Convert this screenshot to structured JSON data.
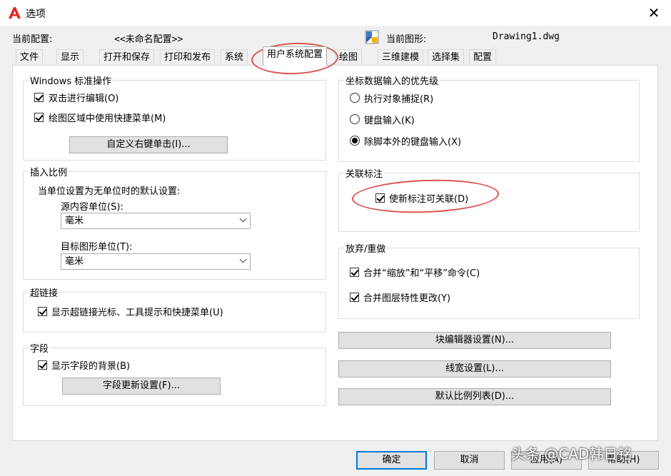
{
  "window": {
    "title": "选项",
    "close_label": "✕"
  },
  "profile": {
    "current_config_label": "当前配置:",
    "current_config_value": "<<未命名配置>>",
    "current_drawing_label": "当前图形:",
    "current_drawing_value": "Drawing1.dwg"
  },
  "tabs": [
    "文件",
    "显示",
    "打开和保存",
    "打印和发布",
    "系统",
    "用户系统配置",
    "绘图",
    "三维建模",
    "选择集",
    "配置"
  ],
  "active_tab": "用户系统配置",
  "windows_ops": {
    "title": "Windows 标准操作",
    "double_click": "双击进行编辑(O)",
    "shortcut_menu": "绘图区域中使用快捷菜单(M)",
    "custom_right_click": "自定义右键单击(I)..."
  },
  "insert_scale": {
    "title": "插入比例",
    "description": "当单位设置为无单位时的默认设置:",
    "source_label": "源内容单位(S):",
    "source_value": "毫米",
    "target_label": "目标图形单位(T):",
    "target_value": "毫米"
  },
  "hyperlink": {
    "title": "超链接",
    "option": "显示超链接光标、工具提示和快捷菜单(U)"
  },
  "fields": {
    "title": "字段",
    "show_background": "显示字段的背景(B)",
    "update_settings": "字段更新设置(F)..."
  },
  "coord_priority": {
    "title": "坐标数据输入的优先级",
    "options": [
      "执行对象捕捉(R)",
      "键盘输入(K)",
      "除脚本外的键盘输入(X)"
    ],
    "selected": "除脚本外的键盘输入(X)"
  },
  "assoc_dim": {
    "title": "关联标注",
    "option": "使新标注可关联(D)"
  },
  "undo_redo": {
    "title": "放弃/重做",
    "combine_zoom_pan": "合并“缩放”和“平移”命令(C)",
    "combine_layer": "合并图层特性更改(Y)"
  },
  "right_buttons": {
    "block_editor": "块编辑器设置(N)...",
    "lineweight": "线宽设置(L)...",
    "scale_list": "默认比例列表(D)..."
  },
  "footer": {
    "ok": "确定",
    "cancel": "取消",
    "apply": "应用(A)",
    "help": "帮助(H)"
  },
  "watermark": "头条 @CAD韩日铭",
  "colors": {
    "accent": "#0078d7",
    "annotation_ring": "#d9534f",
    "logo": "#e0271d"
  }
}
